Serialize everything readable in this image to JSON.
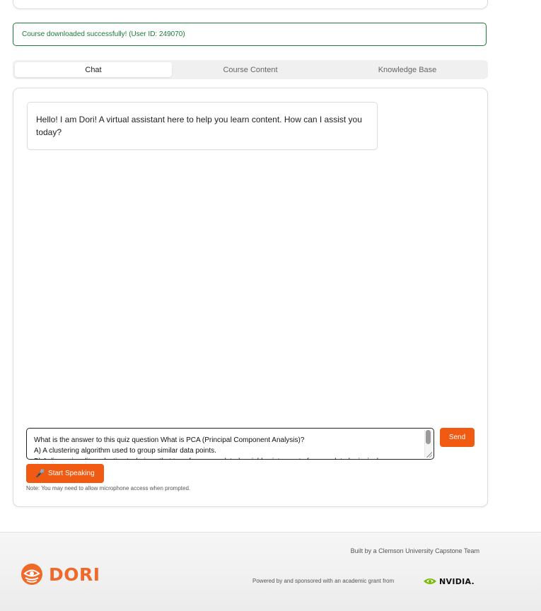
{
  "alert": {
    "text": "Course downloaded successfully! (User ID: 249070)"
  },
  "tabs": [
    {
      "label": "Chat",
      "active": true
    },
    {
      "label": "Course Content",
      "active": false
    },
    {
      "label": "Knowledge Base",
      "active": false
    }
  ],
  "chat": {
    "assistant_message": "Hello! I am Dori! A virtual assistant here to help you learn content. How can I assist you today?",
    "input_value": "What is the answer to this quiz question What is PCA (Principal Component Analysis)?\nA) A clustering algorithm used to group similar data points.\nB) A dimensionality reduction technique that transforms correlated variables into a set of uncorrelated principal",
    "send_label": "Send",
    "speak_icon": "microphone-icon",
    "speak_label": "Start Speaking",
    "note": "Note: You may need to allow microphone access when prompted."
  },
  "footer": {
    "built_by": "Built by a Clemson University Capstone Team",
    "logo_text": "DORI",
    "powered_by": "Powered by and sponsored with an academic grant from",
    "sponsor_logo": "NVIDIA."
  },
  "colors": {
    "accent": "#f05a12",
    "success": "#1f7a3a",
    "brand": "#ef6a2a",
    "nvidia_green": "#76b900"
  }
}
